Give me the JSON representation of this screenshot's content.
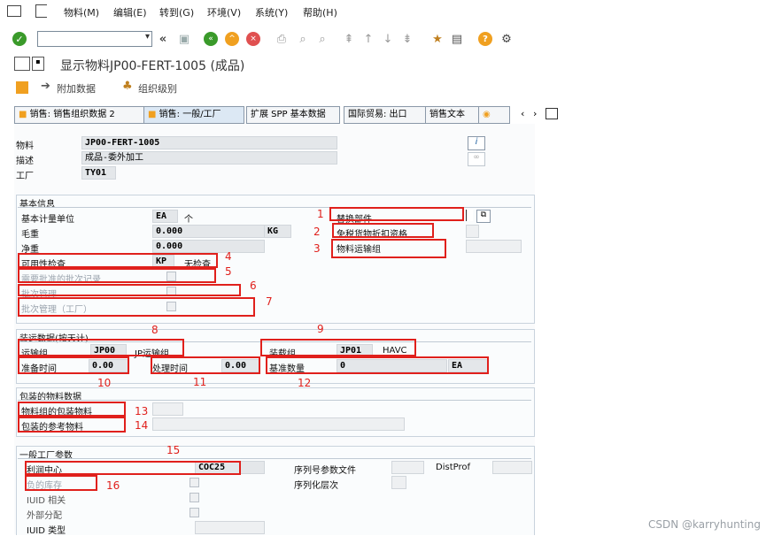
{
  "menu": {
    "items": [
      "物料(M)",
      "编辑(E)",
      "转到(G)",
      "环境(V)",
      "系统(Y)",
      "帮助(H)"
    ]
  },
  "toolbar": {
    "command_value": ""
  },
  "title": "显示物料JP00-FERT-1005 (成品)",
  "appbar": {
    "additional_data": "附加数据",
    "org_levels": "组织级别"
  },
  "tabs": [
    "销售: 销售组织数据 2",
    "销售: 一般/工厂",
    "扩展 SPP 基本数据",
    "国际贸易: 出口",
    "销售文本"
  ],
  "header": {
    "material_label": "物料",
    "material_value": "JP00-FERT-1005",
    "desc_label": "描述",
    "desc_value": "成品-委外加工",
    "plant_label": "工厂",
    "plant_value": "TY01"
  },
  "basic": {
    "title": "基本信息",
    "base_uom_label": "基本计量单位",
    "base_uom_value": "EA",
    "base_uom_text": "个",
    "gross_label": "毛重",
    "gross_value": "0.000",
    "weight_unit": "KG",
    "net_label": "净重",
    "net_value": "0.000",
    "avail_label": "可用性检查",
    "avail_value": "KP",
    "avail_text": "无检查",
    "batch_rec_label": "需要批准的批次记录",
    "batch_mgmt_label": "批次管理",
    "batch_mgmt_plant_label": "批次管理（工厂）",
    "replace_label": "替换部件",
    "replace_value": "",
    "dutyfree_label": "免税货物折扣资格",
    "mat_freight_label": "物料运输组"
  },
  "shipping": {
    "title": "装运数据(按天计)",
    "trans_group_label": "运输组",
    "trans_group_value": "JP00",
    "trans_group_text": "JP运输组",
    "load_group_label": "装载组",
    "load_group_value": "JP01",
    "load_group_text": "HAVC",
    "setup_label": "准备时间",
    "setup_value": "0.00",
    "proc_label": "处理时间",
    "proc_value": "0.00",
    "base_qty_label": "基准数量",
    "base_qty_value": "0",
    "base_qty_unit": "EA"
  },
  "packaging": {
    "title": "包装的物料数据",
    "matgroup_label": "物料组的包装物料",
    "ref_label": "包装的参考物料"
  },
  "general_plant": {
    "title": "一般工厂参数",
    "profit_label": "利润中心",
    "profit_value": "COC25",
    "neg_stock_label": "负的库存",
    "iuid_label": "IUID 相关",
    "ext_alloc_label": "外部分配",
    "iuid_type_label": "IUID 类型",
    "serial_profile_label": "序列号参数文件",
    "distprof_label": "DistProf",
    "serial_level_label": "序列化层次"
  },
  "annotations": [
    "1",
    "2",
    "3",
    "4",
    "5",
    "6",
    "7",
    "8",
    "9",
    "10",
    "11",
    "12",
    "13",
    "14",
    "15",
    "16"
  ],
  "watermark": "CSDN @karryhunting",
  "colors": {
    "annotation_red": "#e0201c",
    "sap_green": "#3a9a2a",
    "sap_orange": "#f0a020"
  }
}
